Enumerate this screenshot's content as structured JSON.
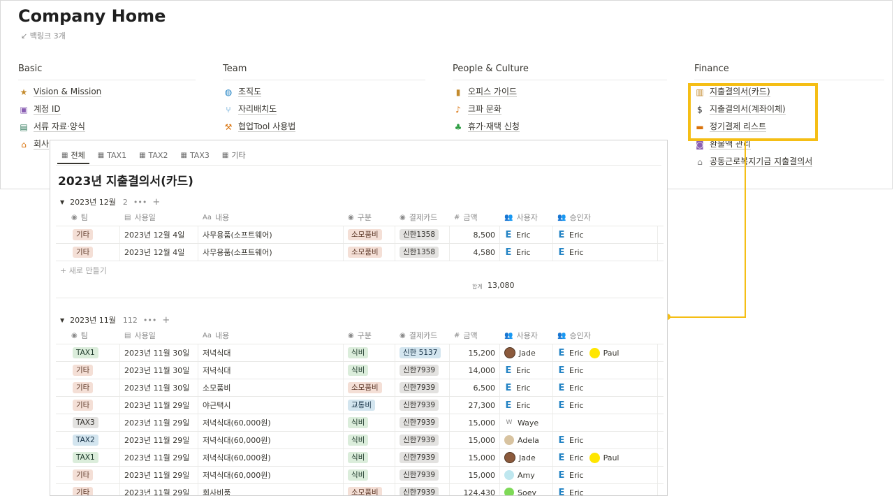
{
  "page": {
    "title": "Company Home",
    "backlinks": "↙ 백링크 3개"
  },
  "columns": [
    {
      "heading": "Basic",
      "items": [
        {
          "icon": "star-icon",
          "glyph": "★",
          "color": "#c38a2c",
          "label": "Vision & Mission"
        },
        {
          "icon": "id-card-icon",
          "glyph": "▣",
          "color": "#8a5fb3",
          "label": "계정 ID"
        },
        {
          "icon": "archive-icon",
          "glyph": "▤",
          "color": "#2f7a5b",
          "label": "서류 자료·양식"
        },
        {
          "icon": "home-icon",
          "glyph": "⌂",
          "color": "#d9730d",
          "label": "회사"
        }
      ]
    },
    {
      "heading": "Team",
      "items": [
        {
          "icon": "globe-icon",
          "glyph": "◍",
          "color": "#2383c4",
          "label": "조직도"
        },
        {
          "icon": "seat-icon",
          "glyph": "⑂",
          "color": "#2383c4",
          "label": "자리배치도"
        },
        {
          "icon": "hammer-icon",
          "glyph": "⚒",
          "color": "#d9730d",
          "label": "협업Tool 사용법"
        }
      ]
    },
    {
      "heading": "People & Culture",
      "items": [
        {
          "icon": "book-icon",
          "glyph": "▮",
          "color": "#c38a2c",
          "label": "오피스 가이드"
        },
        {
          "icon": "guitar-icon",
          "glyph": "♪",
          "color": "#d9730d",
          "label": "크파 문화"
        },
        {
          "icon": "palm-tree-icon",
          "glyph": "♣",
          "color": "#2f9e44",
          "label": "휴가·재택 신청"
        }
      ]
    },
    {
      "heading": "Finance",
      "items": [
        {
          "icon": "receipt-icon",
          "glyph": "▥",
          "color": "#c38a2c",
          "label": "지출결의서(카드)"
        },
        {
          "icon": "dollar-icon",
          "glyph": "$",
          "color": "#1f1f1f",
          "label": "지출결의서(계좌이체)"
        },
        {
          "icon": "credit-card-icon",
          "glyph": "▬",
          "color": "#d9730d",
          "label": "정기결제 리스트"
        },
        {
          "icon": "money-icon",
          "glyph": "◙",
          "color": "#8a5fb3",
          "label": "환불액 관리"
        },
        {
          "icon": "house-icon",
          "glyph": "⌂",
          "color": "#8a8a8a",
          "label": "공동근로복지기금 지출결의서"
        }
      ]
    }
  ],
  "db": {
    "tabs": [
      {
        "label": "전체",
        "active": true
      },
      {
        "label": "TAX1"
      },
      {
        "label": "TAX2"
      },
      {
        "label": "TAX3"
      },
      {
        "label": "기타"
      }
    ],
    "title": "2023년 지출결의서(카드)",
    "headers": {
      "team": "팀",
      "date": "사용일",
      "desc": "내용",
      "cat": "구분",
      "card": "결제카드",
      "amount": "금액",
      "user": "사용자",
      "approver": "승인자"
    },
    "groups": [
      {
        "name": "2023년 12월",
        "count": "2",
        "rows": [
          {
            "team": "기타",
            "team_tag": "etc",
            "date": "2023년 12월 4일",
            "desc": "사무용품(소프트웨어)",
            "cat": "소모품비",
            "cat_tag": "supply",
            "card": "신한1358",
            "card_tag": "card",
            "amount": "8,500",
            "user": "Eric",
            "user_av": "e",
            "approvers": [
              {
                "name": "Eric",
                "av": "e"
              }
            ]
          },
          {
            "team": "기타",
            "team_tag": "etc",
            "date": "2023년 12월 4일",
            "desc": "사무용품(소프트웨어)",
            "cat": "소모품비",
            "cat_tag": "supply",
            "card": "신한1358",
            "card_tag": "card",
            "amount": "4,580",
            "user": "Eric",
            "user_av": "e",
            "approvers": [
              {
                "name": "Eric",
                "av": "e"
              }
            ]
          }
        ],
        "new_label": "+ 새로 만들기",
        "sum_label": "합계",
        "sum_value": "13,080"
      },
      {
        "name": "2023년 11월",
        "count": "112",
        "rows": [
          {
            "team": "TAX1",
            "team_tag": "tax1",
            "date": "2023년 11월 30일",
            "desc": "저녁식대",
            "cat": "식비",
            "cat_tag": "food",
            "card": "신한 5137",
            "card_tag": "card-blue",
            "amount": "15,200",
            "user": "Jade",
            "user_av": "jade",
            "approvers": [
              {
                "name": "Eric",
                "av": "e"
              },
              {
                "name": "Paul",
                "av": "paul"
              }
            ]
          },
          {
            "team": "기타",
            "team_tag": "etc",
            "date": "2023년 11월 30일",
            "desc": "저녁식대",
            "cat": "식비",
            "cat_tag": "food",
            "card": "신한7939",
            "card_tag": "card",
            "amount": "14,000",
            "user": "Eric",
            "user_av": "e",
            "approvers": [
              {
                "name": "Eric",
                "av": "e"
              }
            ]
          },
          {
            "team": "기타",
            "team_tag": "etc",
            "date": "2023년 11월 30일",
            "desc": "소모품비",
            "cat": "소모품비",
            "cat_tag": "supply",
            "card": "신한7939",
            "card_tag": "card",
            "amount": "6,500",
            "user": "Eric",
            "user_av": "e",
            "approvers": [
              {
                "name": "Eric",
                "av": "e"
              }
            ]
          },
          {
            "team": "기타",
            "team_tag": "etc",
            "date": "2023년 11월 29일",
            "desc": "야근택시",
            "cat": "교통비",
            "cat_tag": "trans",
            "card": "신한7939",
            "card_tag": "card",
            "amount": "27,300",
            "user": "Eric",
            "user_av": "e",
            "approvers": [
              {
                "name": "Eric",
                "av": "e"
              }
            ]
          },
          {
            "team": "TAX3",
            "team_tag": "tax3",
            "date": "2023년 11월 29일",
            "desc": "저녁식대(60,000원)",
            "cat": "식비",
            "cat_tag": "food",
            "card": "신한7939",
            "card_tag": "card",
            "amount": "15,000",
            "user": "Waye",
            "user_av": "waye",
            "approvers": []
          },
          {
            "team": "TAX2",
            "team_tag": "tax2",
            "date": "2023년 11월 29일",
            "desc": "저녁식대(60,000원)",
            "cat": "식비",
            "cat_tag": "food",
            "card": "신한7939",
            "card_tag": "card",
            "amount": "15,000",
            "user": "Adela",
            "user_av": "adela",
            "approvers": [
              {
                "name": "Eric",
                "av": "e"
              }
            ]
          },
          {
            "team": "TAX1",
            "team_tag": "tax1",
            "date": "2023년 11월 29일",
            "desc": "저녁식대(60,000원)",
            "cat": "식비",
            "cat_tag": "food",
            "card": "신한7939",
            "card_tag": "card",
            "amount": "15,000",
            "user": "Jade",
            "user_av": "jade",
            "approvers": [
              {
                "name": "Eric",
                "av": "e"
              },
              {
                "name": "Paul",
                "av": "paul"
              }
            ]
          },
          {
            "team": "기타",
            "team_tag": "etc",
            "date": "2023년 11월 29일",
            "desc": "저녁식대(60,000원)",
            "cat": "식비",
            "cat_tag": "food",
            "card": "신한7939",
            "card_tag": "card",
            "amount": "15,000",
            "user": "Amy",
            "user_av": "amy",
            "approvers": [
              {
                "name": "Eric",
                "av": "e"
              }
            ]
          },
          {
            "team": "기타",
            "team_tag": "etc",
            "date": "2023년 11월 29일",
            "desc": "회사비품",
            "cat": "소모품비",
            "cat_tag": "supply",
            "card": "신한7939",
            "card_tag": "card",
            "amount": "124,430",
            "user": "Soey",
            "user_av": "soey",
            "approvers": [
              {
                "name": "Eric",
                "av": "e"
              }
            ]
          }
        ]
      }
    ]
  },
  "colors": {
    "highlight": "#f5be15",
    "accent_blue": "#2383c4"
  }
}
